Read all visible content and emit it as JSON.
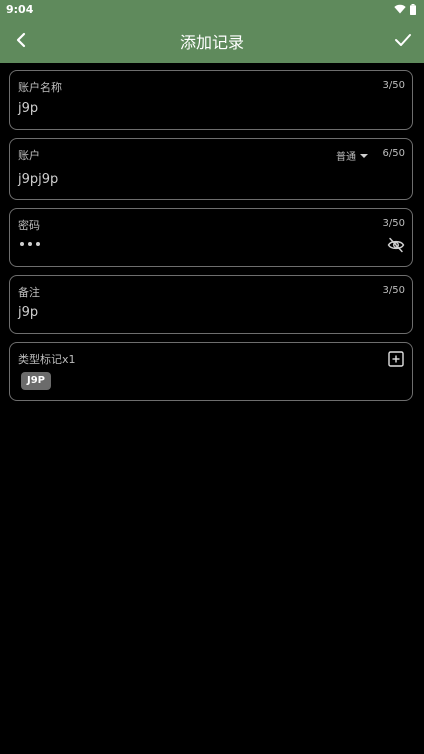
{
  "status_bar": {
    "time": "9:04",
    "icons": [
      "wifi-icon",
      "battery-icon"
    ]
  },
  "app_bar": {
    "title": "添加记录",
    "back_icon": "chevron-left-icon",
    "confirm_icon": "check-icon",
    "background_color": "#5f8a5c"
  },
  "form": {
    "account_name": {
      "label": "账户名称",
      "counter": "3/50",
      "value": "j9p"
    },
    "account": {
      "label": "账户",
      "mode": "普通",
      "counter": "6/50",
      "value": "j9pj9p"
    },
    "password": {
      "label": "密码",
      "counter": "3/50",
      "masked_length": 3,
      "visibility_icon": "eye-off-icon"
    },
    "note": {
      "label": "备注",
      "counter": "3/50",
      "value": "j9p"
    },
    "tags": {
      "label": "类型标记x1",
      "add_icon": "plus-square-icon",
      "items": [
        "J9P"
      ]
    }
  }
}
